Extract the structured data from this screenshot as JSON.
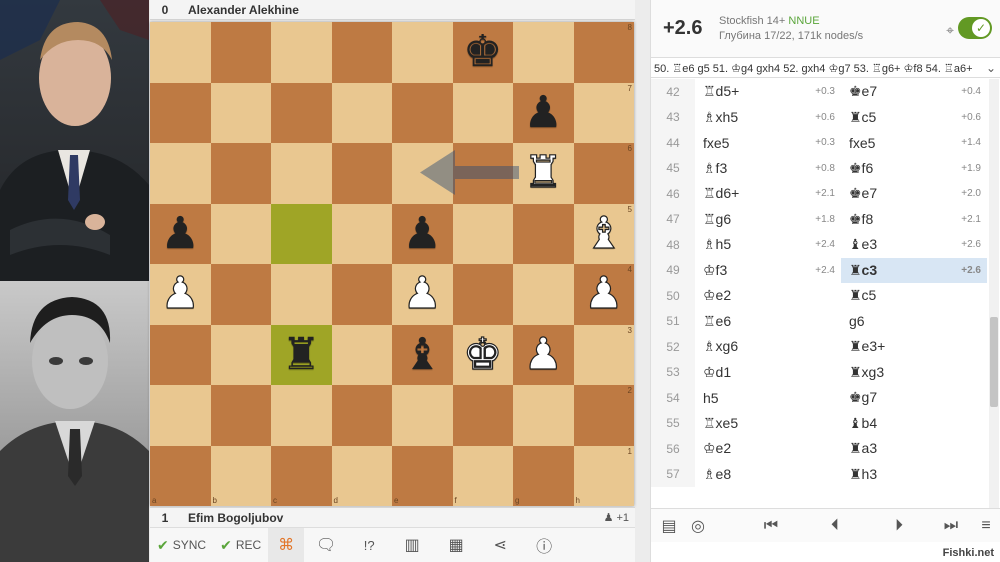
{
  "players": {
    "top": {
      "rating": "0",
      "name": "Alexander Alekhine"
    },
    "bottom": {
      "rating": "1",
      "name": "Efim Bogoljubov",
      "material": "+1",
      "material_icon": "pawn-icon"
    }
  },
  "board": {
    "ranks": [
      "8",
      "7",
      "6",
      "5",
      "4",
      "3",
      "2",
      "1"
    ],
    "files": [
      "a",
      "b",
      "c",
      "d",
      "e",
      "f",
      "g",
      "h"
    ],
    "highlight_squares": [
      "c5",
      "c3"
    ],
    "arrow": {
      "from": "g6",
      "to": "e6"
    },
    "pieces": [
      {
        "square": "f8",
        "piece": "king",
        "color": "black"
      },
      {
        "square": "g7",
        "piece": "pawn",
        "color": "black"
      },
      {
        "square": "g6",
        "piece": "rook",
        "color": "white"
      },
      {
        "square": "a5",
        "piece": "pawn",
        "color": "black"
      },
      {
        "square": "e5",
        "piece": "pawn",
        "color": "black"
      },
      {
        "square": "h5",
        "piece": "bishop",
        "color": "white"
      },
      {
        "square": "a4",
        "piece": "pawn",
        "color": "white"
      },
      {
        "square": "e4",
        "piece": "pawn",
        "color": "white"
      },
      {
        "square": "h4",
        "piece": "pawn",
        "color": "white"
      },
      {
        "square": "c3",
        "piece": "rook",
        "color": "black"
      },
      {
        "square": "e3",
        "piece": "bishop",
        "color": "black"
      },
      {
        "square": "f3",
        "piece": "king",
        "color": "white"
      },
      {
        "square": "g3",
        "piece": "pawn",
        "color": "white"
      }
    ]
  },
  "toolbar": {
    "sync_label": "SYNC",
    "rec_label": "REC",
    "glyphs_label": "!?"
  },
  "engine": {
    "score": "+2.6",
    "name": "Stockfish 14+",
    "nnue": "NNUE",
    "depth_info": "Глубина 17/22, 171k nodes/s",
    "pv": "50. ♖e6 g5 51. ♔g4 gxh4 52. gxh4 ♔g7 53. ♖g6+ ♔f8 54. ♖a6+"
  },
  "moves": [
    {
      "num": "42",
      "white": "♖d5+",
      "white_eval": "+0.3",
      "black": "♚e7",
      "black_eval": "+0.4"
    },
    {
      "num": "43",
      "white": "♗xh5",
      "white_eval": "+0.6",
      "black": "♜c5",
      "black_eval": "+0.6"
    },
    {
      "num": "44",
      "white": "fxe5",
      "white_eval": "+0.3",
      "black": "fxe5",
      "black_eval": "+1.4"
    },
    {
      "num": "45",
      "white": "♗f3",
      "white_eval": "+0.8",
      "black": "♚f6",
      "black_eval": "+1.9"
    },
    {
      "num": "46",
      "white": "♖d6+",
      "white_eval": "+2.1",
      "black": "♚e7",
      "black_eval": "+2.0"
    },
    {
      "num": "47",
      "white": "♖g6",
      "white_eval": "+1.8",
      "black": "♚f8",
      "black_eval": "+2.1"
    },
    {
      "num": "48",
      "white": "♗h5",
      "white_eval": "+2.4",
      "black": "♝e3",
      "black_eval": "+2.6"
    },
    {
      "num": "49",
      "white": "♔f3",
      "white_eval": "+2.4",
      "black": "♜c3",
      "black_eval": "+2.6",
      "current": true
    },
    {
      "num": "50",
      "white": "♔e2",
      "white_eval": "",
      "black": "♜c5",
      "black_eval": ""
    },
    {
      "num": "51",
      "white": "♖e6",
      "white_eval": "",
      "black": "g6",
      "black_eval": ""
    },
    {
      "num": "52",
      "white": "♗xg6",
      "white_eval": "",
      "black": "♜e3+",
      "black_eval": ""
    },
    {
      "num": "53",
      "white": "♔d1",
      "white_eval": "",
      "black": "♜xg3",
      "black_eval": ""
    },
    {
      "num": "54",
      "white": "h5",
      "white_eval": "",
      "black": "♚g7",
      "black_eval": ""
    },
    {
      "num": "55",
      "white": "♖xe5",
      "white_eval": "",
      "black": "♝b4",
      "black_eval": ""
    },
    {
      "num": "56",
      "white": "♔e2",
      "white_eval": "",
      "black": "♜a3",
      "black_eval": ""
    },
    {
      "num": "57",
      "white": "♗e8",
      "white_eval": "",
      "black": "♜h3",
      "black_eval": ""
    }
  ],
  "watermark": "Fishki.net"
}
